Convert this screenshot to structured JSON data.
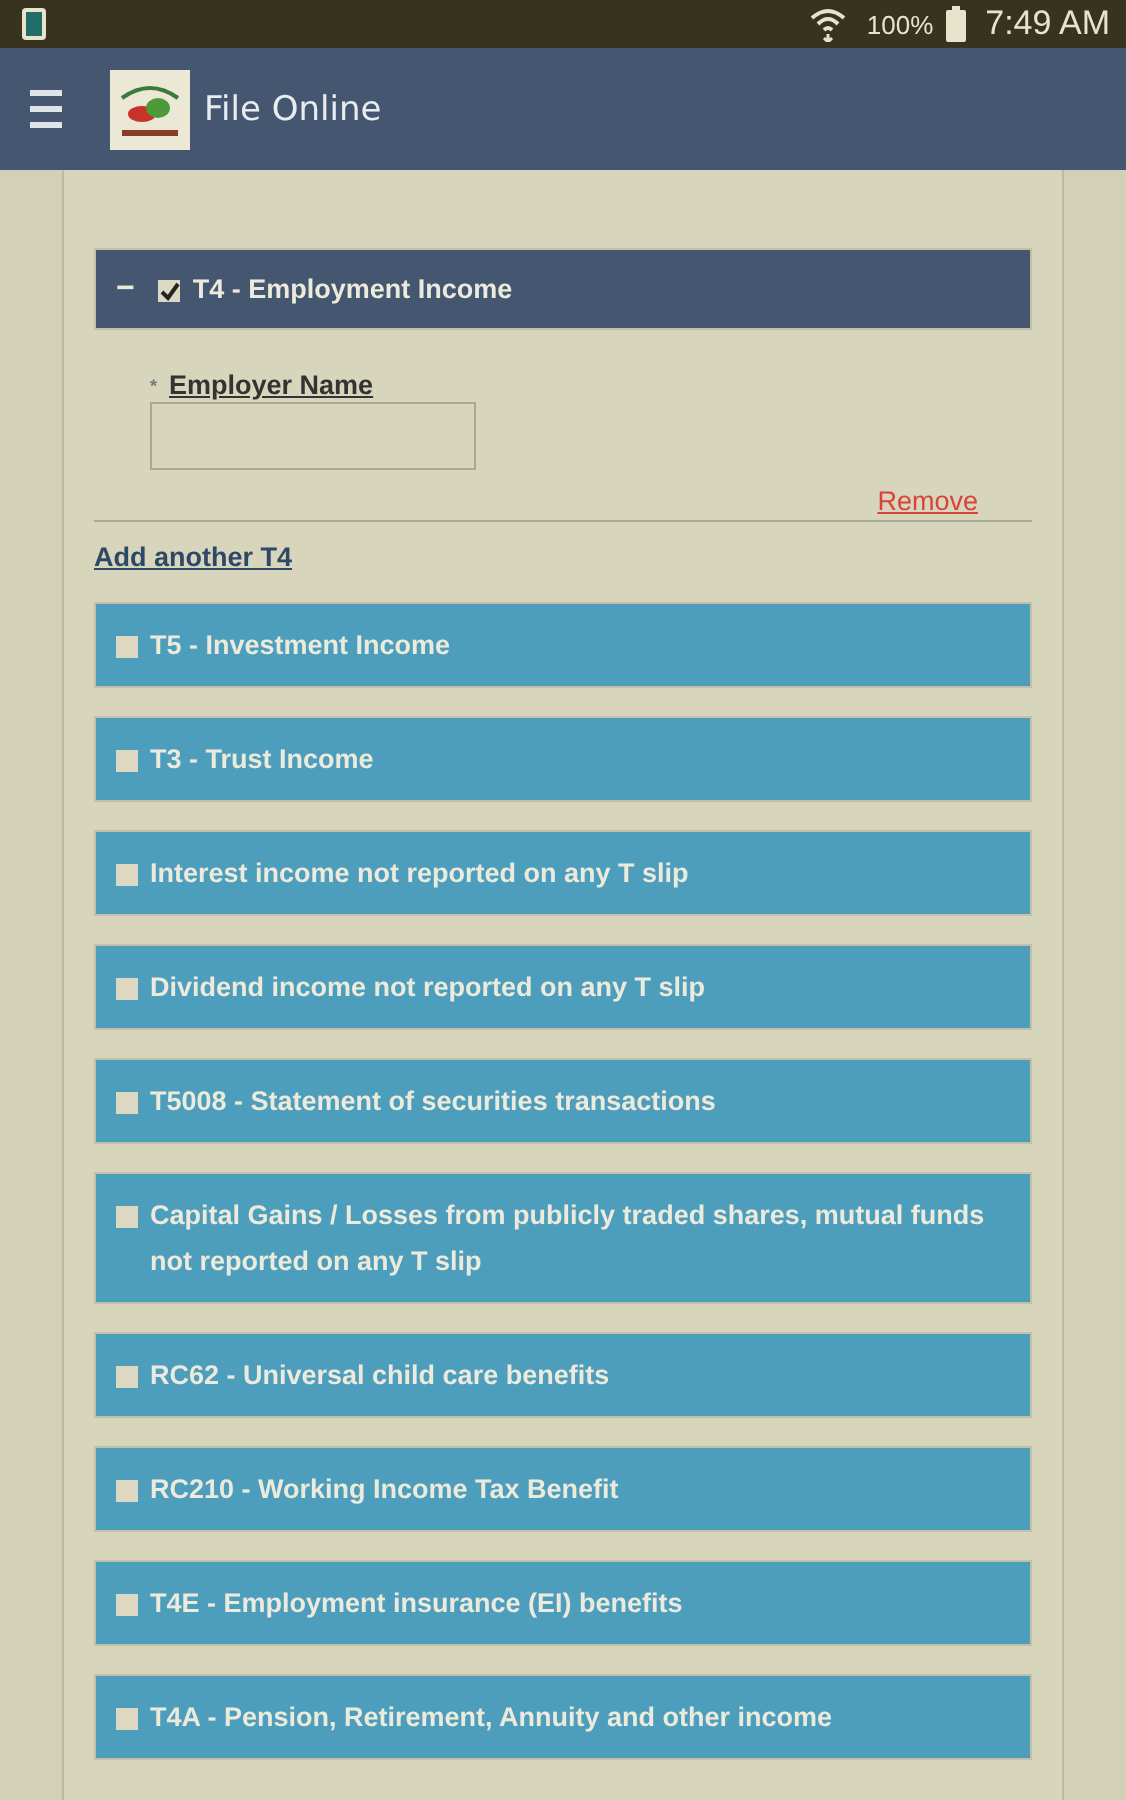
{
  "status_bar": {
    "battery": "100%",
    "time": "7:49 AM"
  },
  "app_bar": {
    "title": "File Online"
  },
  "sections": [
    {
      "label": "T4 - Employment Income",
      "checked": true,
      "expanded": true,
      "toggle": "−",
      "fields": [
        {
          "label": "Employer Name",
          "required": true,
          "required_mark": "*"
        }
      ],
      "remove_link": "Remove",
      "add_link": "Add another T4"
    },
    {
      "label": "T5 - Investment Income",
      "checked": false,
      "expanded": false
    },
    {
      "label": "T3 - Trust Income",
      "checked": false,
      "expanded": false
    },
    {
      "label": "Interest income not reported on any T slip",
      "checked": false,
      "expanded": false
    },
    {
      "label": "Dividend income not reported on any T slip",
      "checked": false,
      "expanded": false
    },
    {
      "label": "T5008 - Statement of securities transactions",
      "checked": false,
      "expanded": false
    },
    {
      "label": "Capital Gains / Losses from publicly traded shares, mutual funds not reported on any T slip",
      "checked": false,
      "expanded": false
    },
    {
      "label": "RC62 - Universal child care benefits",
      "checked": false,
      "expanded": false
    },
    {
      "label": "RC210 - Working Income Tax Benefit",
      "checked": false,
      "expanded": false
    },
    {
      "label": "T4E - Employment insurance (EI) benefits",
      "checked": false,
      "expanded": false
    },
    {
      "label": "T4A - Pension, Retirement, Annuity and other income",
      "checked": false,
      "expanded": false
    }
  ]
}
